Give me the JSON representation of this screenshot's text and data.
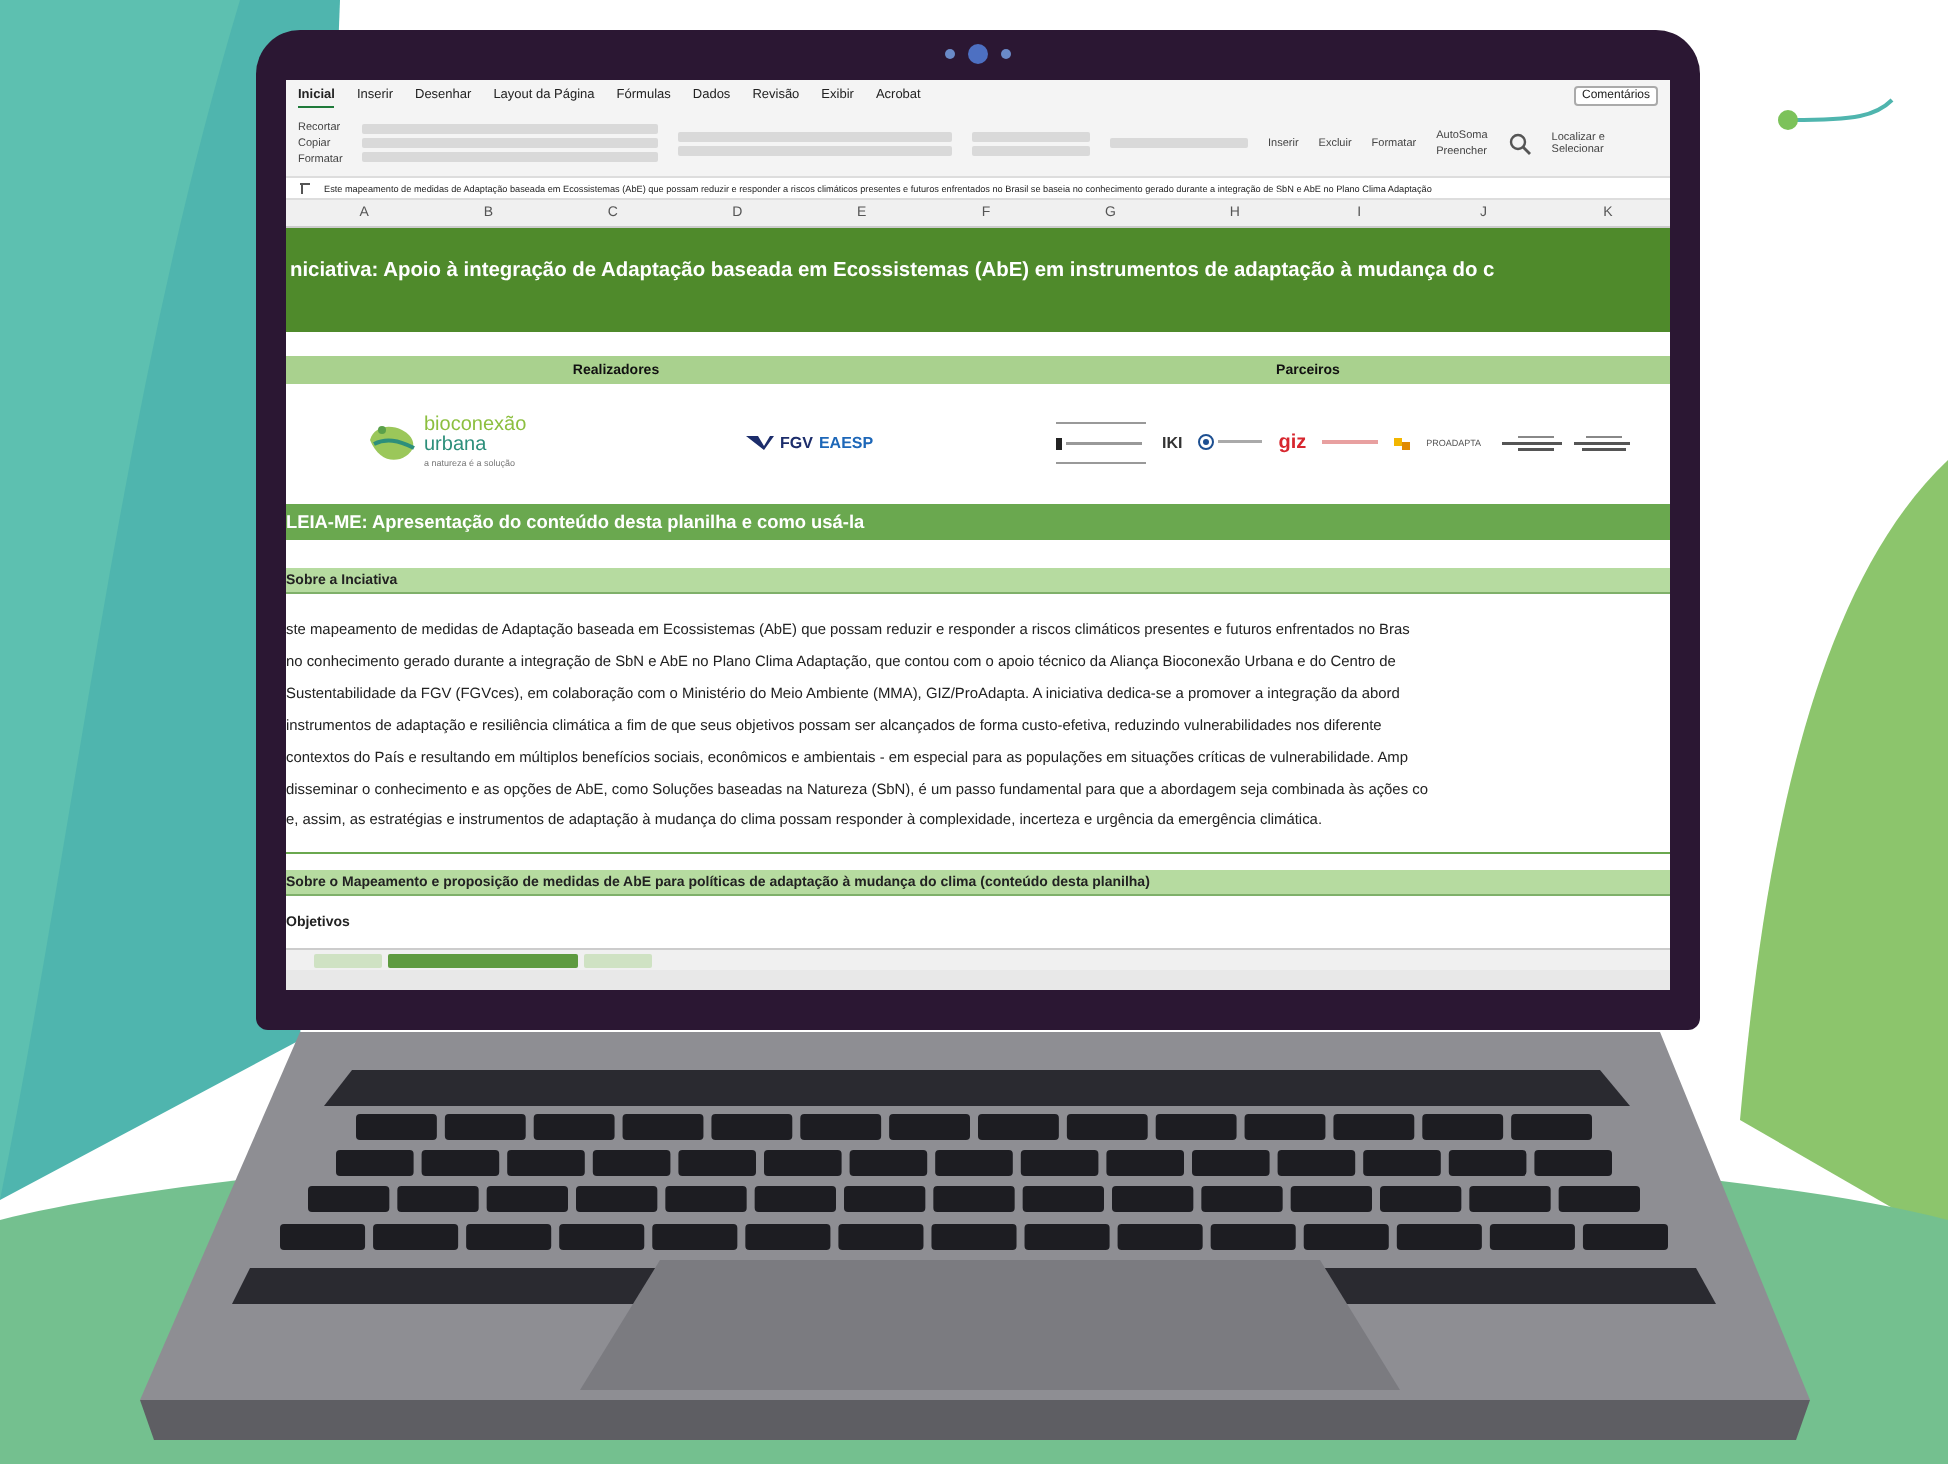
{
  "ribbon": {
    "tabs": [
      {
        "label": "Inicial",
        "selected": true
      },
      {
        "label": "Inserir",
        "selected": false
      },
      {
        "label": "Desenhar",
        "selected": false
      },
      {
        "label": "Layout da Página",
        "selected": false
      },
      {
        "label": "Fórmulas",
        "selected": false
      },
      {
        "label": "Dados",
        "selected": false
      },
      {
        "label": "Revisão",
        "selected": false
      },
      {
        "label": "Exibir",
        "selected": false
      },
      {
        "label": "Acrobat",
        "selected": false
      }
    ],
    "comments": "Comentários",
    "clipboard": [
      "Recortar",
      "Copiar",
      "Formatar"
    ],
    "cells": [
      "Inserir",
      "Excluir",
      "Formatar"
    ],
    "editing": [
      "AutoSoma",
      "Preencher"
    ],
    "find": "Localizar e Selecionar"
  },
  "formula_bar": {
    "content": "Este mapeamento de medidas de Adaptação baseada em Ecossistemas (AbE) que possam reduzir e responder a riscos climáticos presentes e futuros enfrentados no Brasil se baseia no conhecimento gerado durante a integração de SbN e AbE no Plano Clima Adaptação"
  },
  "columns": [
    "A",
    "B",
    "C",
    "D",
    "E",
    "F",
    "G",
    "H",
    "I",
    "J",
    "K"
  ],
  "sheet": {
    "title": "niciativa: Apoio à integração de Adaptação baseada em Ecossistemas (AbE) em instrumentos de adaptação à mudança do c",
    "realizadores": "Realizadores",
    "parceiros": "Parceiros",
    "bioconexao": {
      "name1": "bioconexão",
      "name2": "urbana",
      "tagline": "a natureza é a solução"
    },
    "fgv": {
      "name1": "FGV",
      "name2": "EAESP"
    },
    "partners": {
      "iki": "IKI",
      "giz": "giz",
      "proadapta": "PROADAPTA"
    },
    "readme": "LEIA-ME: Apresentação do conteúdo desta planilha e como usá-la",
    "section1": "Sobre a Inciativa",
    "paragraph": [
      "ste mapeamento de medidas de Adaptação baseada em Ecossistemas (AbE) que possam reduzir e responder a riscos climáticos presentes e futuros enfrentados no Bras",
      "no conhecimento gerado durante a integração de SbN e AbE no Plano Clima Adaptação, que contou com o apoio técnico da Aliança Bioconexão Urbana e do Centro de",
      "Sustentabilidade da FGV (FGVces), em colaboração com o Ministério do Meio Ambiente (MMA), GIZ/ProAdapta. A iniciativa dedica-se a promover a integração da abord",
      "instrumentos de adaptação e resiliência climática a fim de que seus objetivos possam ser alcançados de forma custo-efetiva, reduzindo vulnerabilidades nos diferente",
      "contextos do País e resultando em múltiplos benefícios sociais, econômicos e ambientais - em especial para as populações em situações críticas de vulnerabilidade. Amp",
      "disseminar o conhecimento e as opções de AbE, como Soluções baseadas na Natureza (SbN), é um passo fundamental para que a abordagem seja combinada às ações co",
      "e, assim, as estratégias e instrumentos de adaptação à mudança do clima possam responder à complexidade, incerteza e urgência da emergência climática."
    ],
    "section2": "Sobre o Mapeamento e proposição de medidas de AbE para políticas de adaptação à mudança do clima (conteúdo desta planilha)",
    "objectives": "Objetivos"
  },
  "sheet_tabs": [
    {
      "selected": false
    },
    {
      "selected": true
    },
    {
      "selected": false
    }
  ]
}
